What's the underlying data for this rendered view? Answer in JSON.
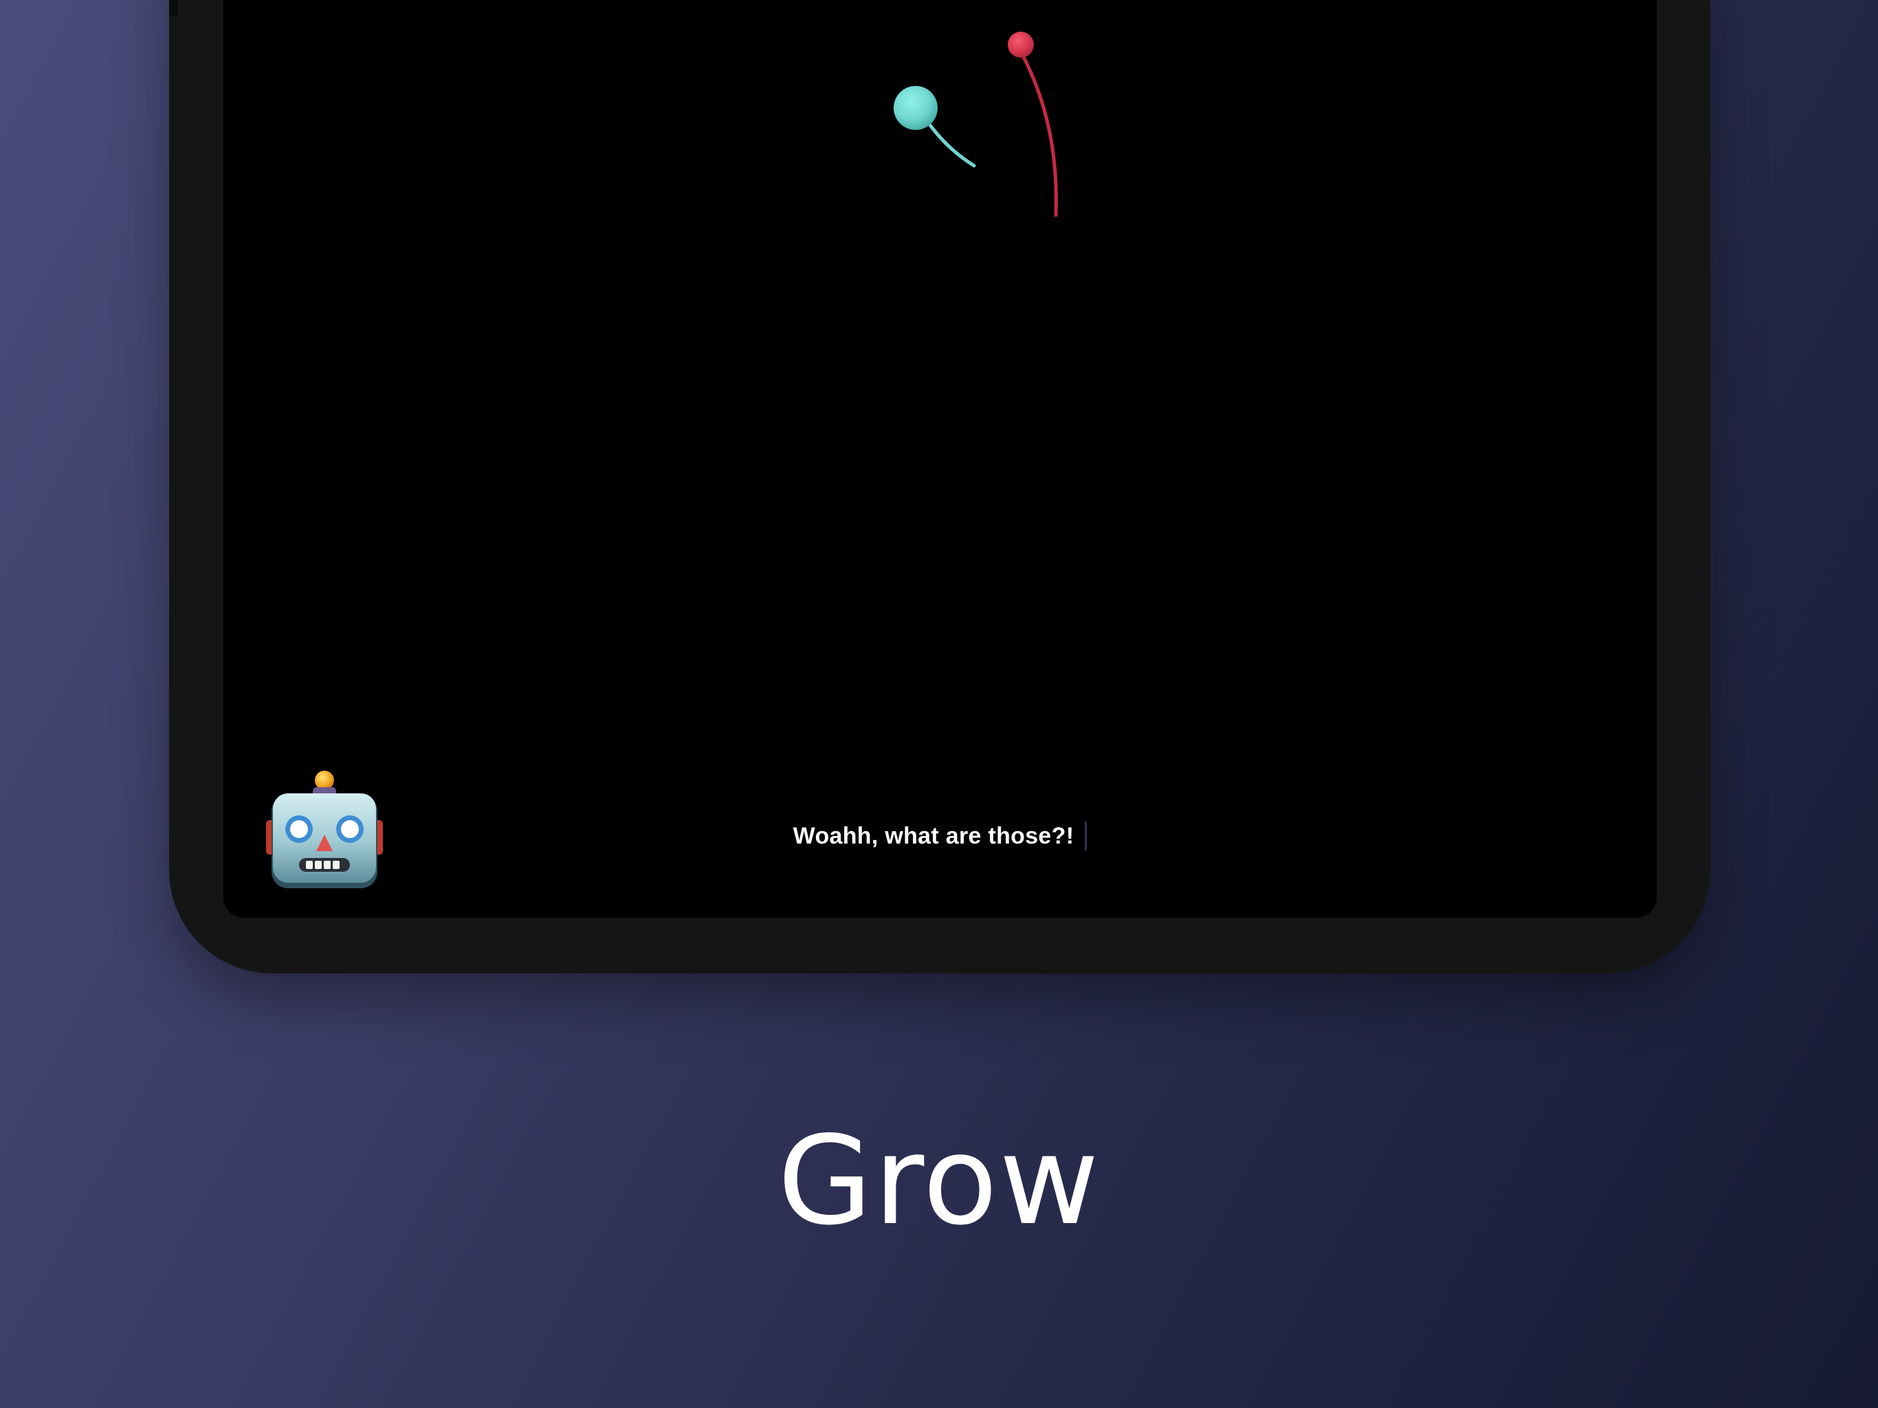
{
  "screen": {
    "subtitle": "Woahh, what are those?!",
    "character_icon": "robot-face-icon",
    "creatures": [
      {
        "name": "teal-creature",
        "color": "#6fd6cf"
      },
      {
        "name": "red-creature",
        "color": "#d8384f"
      }
    ]
  },
  "promo": {
    "title": "Grow"
  },
  "colors": {
    "background_light": "#4a4c7a",
    "background_dark": "#171a33",
    "device_frame": "#151515",
    "screen": "#000000",
    "teal_creature": "#6fd6cf",
    "red_creature": "#d8384f"
  }
}
